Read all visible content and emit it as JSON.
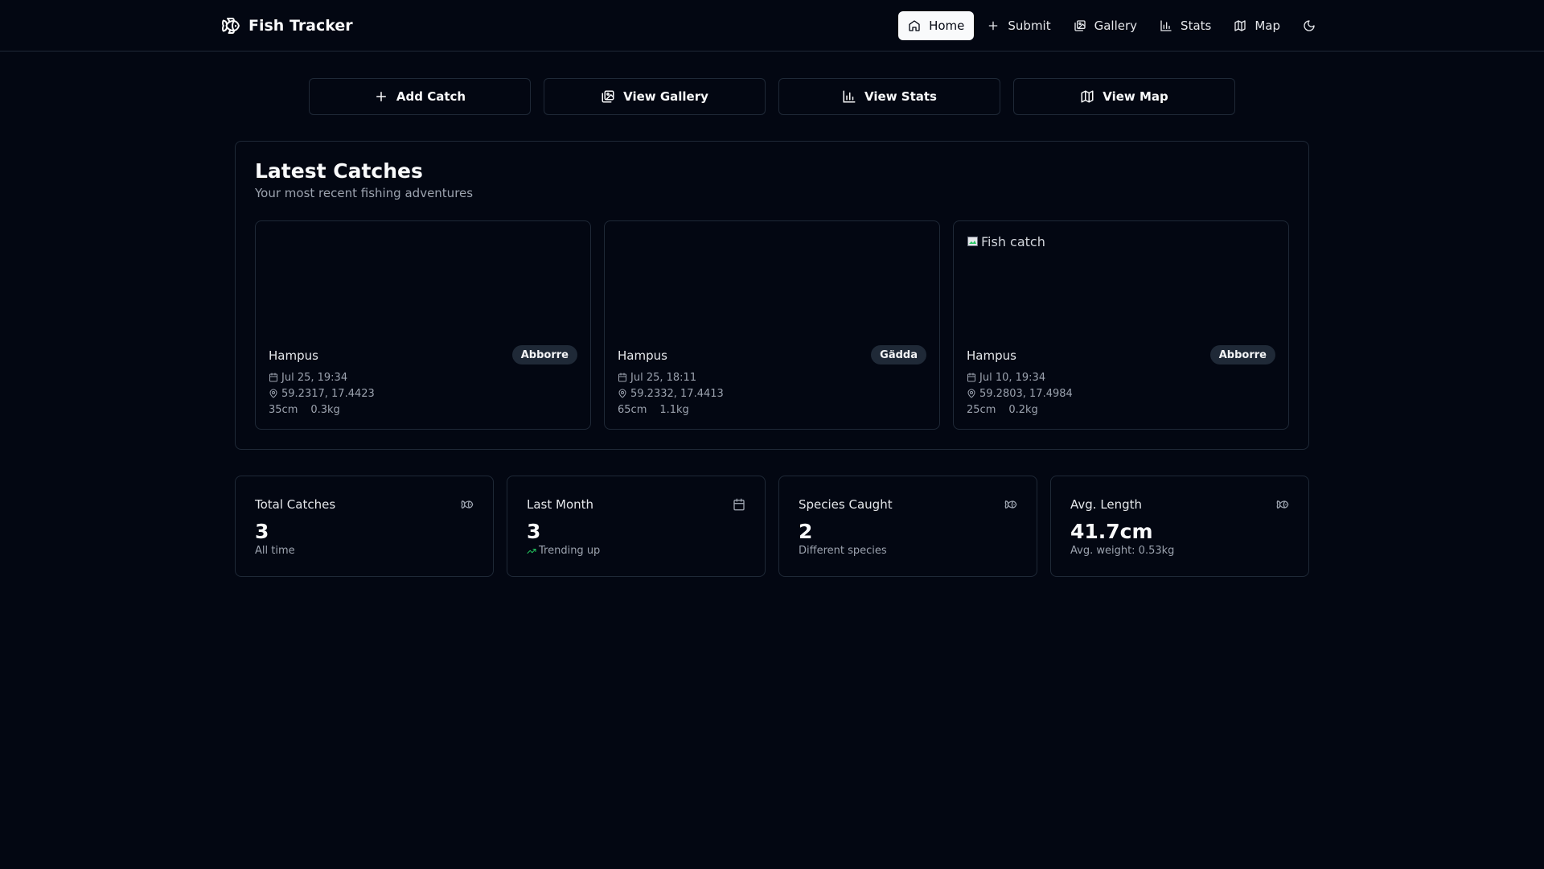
{
  "app": {
    "title": "Fish Tracker",
    "logo_icon": "fish-icon"
  },
  "nav": {
    "items": [
      {
        "label": "Home",
        "icon": "home-icon",
        "active": true
      },
      {
        "label": "Submit",
        "icon": "plus-icon",
        "active": false
      },
      {
        "label": "Gallery",
        "icon": "gallery-icon",
        "active": false
      },
      {
        "label": "Stats",
        "icon": "bar-chart-icon",
        "active": false
      },
      {
        "label": "Map",
        "icon": "map-icon",
        "active": false
      }
    ],
    "theme_toggle_icon": "moon-icon"
  },
  "quick_actions": [
    {
      "label": "Add Catch",
      "icon": "plus-icon"
    },
    {
      "label": "View Gallery",
      "icon": "gallery-icon"
    },
    {
      "label": "View Stats",
      "icon": "bar-chart-icon"
    },
    {
      "label": "View Map",
      "icon": "map-icon"
    }
  ],
  "latest_catches": {
    "title": "Latest Catches",
    "subtitle": "Your most recent fishing adventures",
    "items": [
      {
        "image_alt": "",
        "angler": "Hampus",
        "species": "Abborre",
        "date": "Jul 25, 19:34",
        "coords": "59.2317, 17.4423",
        "length": "35cm",
        "weight": "0.3kg"
      },
      {
        "image_alt": "",
        "angler": "Hampus",
        "species": "Gädda",
        "date": "Jul 25, 18:11",
        "coords": "59.2332, 17.4413",
        "length": "65cm",
        "weight": "1.1kg"
      },
      {
        "image_alt": "Fish catch",
        "angler": "Hampus",
        "species": "Abborre",
        "date": "Jul 10, 19:34",
        "coords": "59.2803, 17.4984",
        "length": "25cm",
        "weight": "0.2kg"
      }
    ]
  },
  "stats": [
    {
      "title": "Total Catches",
      "icon": "fish-icon",
      "value": "3",
      "note": "All time",
      "trend": false
    },
    {
      "title": "Last Month",
      "icon": "calendar-icon",
      "value": "3",
      "note": "Trending up",
      "trend": true
    },
    {
      "title": "Species Caught",
      "icon": "fish-icon",
      "value": "2",
      "note": "Different species",
      "trend": false
    },
    {
      "title": "Avg. Length",
      "icon": "fish-icon",
      "value": "41.7cm",
      "note": "Avg. weight: 0.53kg",
      "trend": false
    }
  ],
  "colors": {
    "background": "#030712",
    "border": "#1f2937",
    "badge_bg": "#1f2937",
    "muted_text": "#9ca3af",
    "trend_green": "#22c55e"
  }
}
